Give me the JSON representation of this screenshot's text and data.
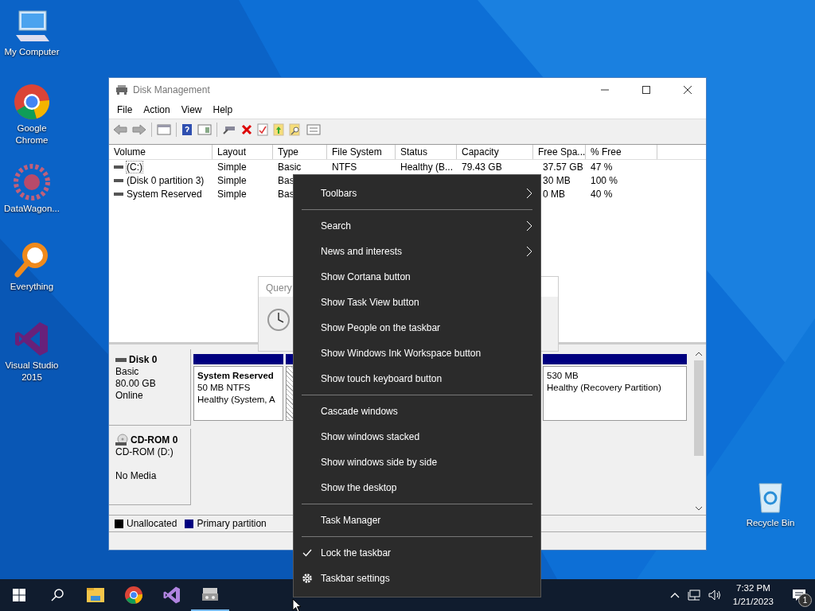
{
  "desktop_icons": [
    {
      "label": "My Computer",
      "kind": "computer"
    },
    {
      "label": "Google Chrome",
      "kind": "chrome"
    },
    {
      "label": "DataWagon...",
      "kind": "datawagon"
    },
    {
      "label": "Everything",
      "kind": "everything"
    },
    {
      "label": "Visual Studio 2015",
      "kind": "vs"
    },
    {
      "label": "Recycle Bin",
      "kind": "recycle"
    }
  ],
  "window": {
    "title": "Disk Management",
    "menu": [
      "File",
      "Action",
      "View",
      "Help"
    ],
    "columns": [
      "Volume",
      "Layout",
      "Type",
      "File System",
      "Status",
      "Capacity",
      "Free Spa...",
      "% Free"
    ],
    "rows": [
      {
        "cells": [
          "(C:)",
          "Simple",
          "Basic",
          "NTFS",
          "Healthy (B...",
          "79.43 GB",
          "37.57 GB",
          "47 %"
        ],
        "selected": true
      },
      {
        "cells": [
          "(Disk 0 partition 3)",
          "Simple",
          "Bas",
          "",
          "",
          "",
          "30 MB",
          "100 %"
        ],
        "selected": false
      },
      {
        "cells": [
          "System Reserved",
          "Simple",
          "Bas",
          "",
          "",
          "",
          "0 MB",
          "40 %"
        ],
        "selected": false
      }
    ],
    "disks": [
      {
        "kind": "disk",
        "name": "Disk 0",
        "lines": [
          "Basic",
          "80.00 GB",
          "Online"
        ],
        "partitions": [
          {
            "title": "System Reserved",
            "lines": [
              "50 MB NTFS",
              "Healthy (System, A"
            ],
            "selected": false
          },
          {
            "selected": true
          },
          {
            "lines": [
              "530 MB",
              "Healthy (Recovery Partition)"
            ],
            "selected": false
          }
        ]
      },
      {
        "kind": "cdrom",
        "name": "CD-ROM 0",
        "lines": [
          "CD-ROM (D:)",
          "No Media"
        ]
      }
    ],
    "legend": [
      {
        "label": "Unallocated",
        "color": "#000000"
      },
      {
        "label": "Primary partition",
        "color": "#00007f"
      }
    ]
  },
  "dialog": {
    "title": "Query"
  },
  "context_menu": [
    {
      "kind": "submenu",
      "label": "Toolbars"
    },
    {
      "kind": "separator"
    },
    {
      "kind": "submenu",
      "label": "Search"
    },
    {
      "kind": "submenu",
      "label": "News and interests"
    },
    {
      "kind": "item",
      "label": "Show Cortana button"
    },
    {
      "kind": "item",
      "label": "Show Task View button"
    },
    {
      "kind": "item",
      "label": "Show People on the taskbar"
    },
    {
      "kind": "item",
      "label": "Show Windows Ink Workspace button"
    },
    {
      "kind": "item",
      "label": "Show touch keyboard button"
    },
    {
      "kind": "separator"
    },
    {
      "kind": "item",
      "label": "Cascade windows"
    },
    {
      "kind": "item",
      "label": "Show windows stacked"
    },
    {
      "kind": "item",
      "label": "Show windows side by side"
    },
    {
      "kind": "item",
      "label": "Show the desktop"
    },
    {
      "kind": "separator"
    },
    {
      "kind": "item",
      "label": "Task Manager"
    },
    {
      "kind": "separator"
    },
    {
      "kind": "check",
      "label": "Lock the taskbar",
      "checked": true
    },
    {
      "kind": "gear",
      "label": "Taskbar settings"
    }
  ],
  "taskbar": {
    "apps": [
      {
        "kind": "explorer",
        "active": false
      },
      {
        "kind": "chrome",
        "active": false
      },
      {
        "kind": "vs",
        "active": false
      },
      {
        "kind": "diskmgmt",
        "active": true
      }
    ],
    "time": "7:32 PM",
    "date": "1/21/2023",
    "notifications": "1"
  }
}
